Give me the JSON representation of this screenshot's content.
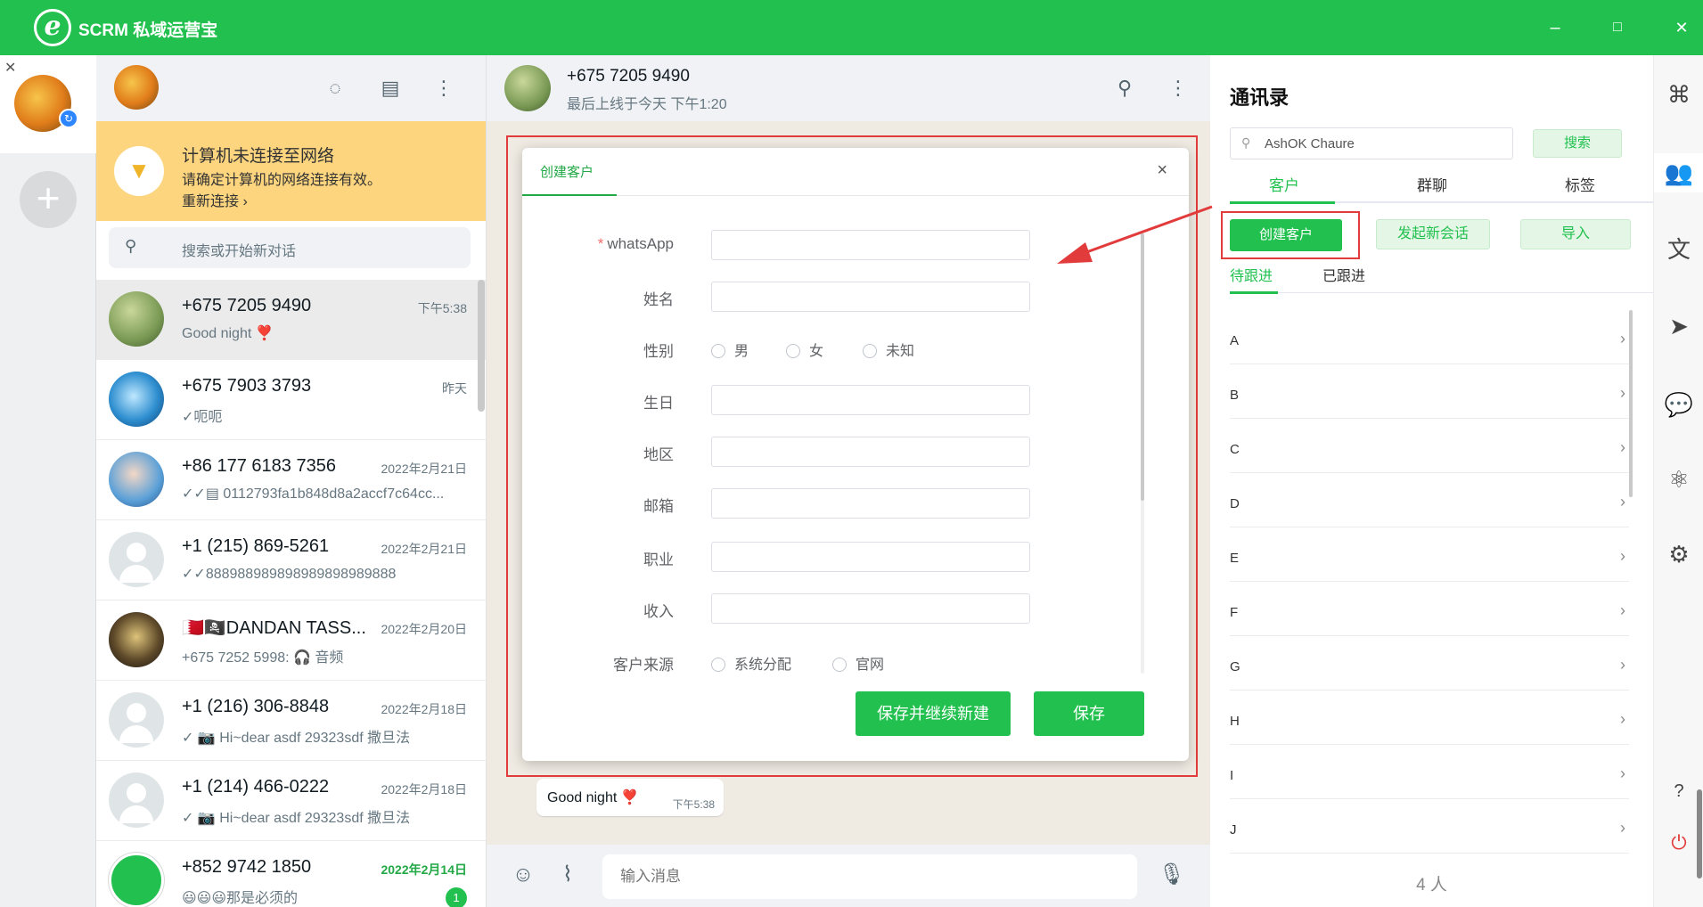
{
  "app": {
    "title": "SCRM 私域运营宝",
    "logo_glyph": "e"
  },
  "window_controls": {
    "minimize": "–",
    "maximize": "□",
    "close": "✕"
  },
  "account": {
    "close": "✕",
    "badge": "↻",
    "add": "+"
  },
  "chatlist": {
    "banner": {
      "title": "计算机未连接至网络",
      "message": "请确定计算机的网络连接有效。",
      "action": "重新连接 ›"
    },
    "search_placeholder": "搜索或开始新对话",
    "chats": [
      {
        "name": "+675 7205 9490",
        "time": "下午5:38",
        "preview": "Good night ❣️"
      },
      {
        "name": "+675 7903 3793",
        "time": "昨天",
        "preview": "✓呃呃"
      },
      {
        "name": "+86 177 6183 7356",
        "time": "2022年2月21日",
        "preview": "✓✓▤ 0112793fa1b848d8a2accf7c64cc..."
      },
      {
        "name": "+1 (215) 869-5261",
        "time": "2022年2月21日",
        "preview": "✓✓888988989898989898989888"
      },
      {
        "name": "🇧🇭🏴‍☠️DANDAN TASS...",
        "time": "2022年2月20日",
        "preview": "+675 7252 5998: 🎧 音频"
      },
      {
        "name": "+1 (216) 306-8848",
        "time": "2022年2月18日",
        "preview": "✓ 📷 Hi~dear asdf 29323sdf 撒旦法"
      },
      {
        "name": "+1 (214) 466-0222",
        "time": "2022年2月18日",
        "preview": "✓ 📷 Hi~dear asdf 29323sdf 撒旦法"
      },
      {
        "name": "+852 9742 1850",
        "time": "2022年2月14日",
        "preview": "😃😃😃那是必须的",
        "unread": "1"
      }
    ]
  },
  "chat": {
    "contact_name": "+675 7205 9490",
    "status": "最后上线于今天 下午1:20",
    "last_message": {
      "text": "Good night ❣️",
      "time": "下午5:38"
    },
    "composer_placeholder": "输入消息"
  },
  "dialog": {
    "tab": "创建客户",
    "close": "×",
    "fields": {
      "whatsapp": {
        "label": "whatsApp",
        "required_mark": "*"
      },
      "name": "姓名",
      "gender": "性别",
      "birthday": "生日",
      "region": "地区",
      "email": "邮箱",
      "occupation": "职业",
      "income": "收入",
      "source": "客户来源"
    },
    "gender_options": [
      "男",
      "女",
      "未知"
    ],
    "source_options": [
      "系统分配",
      "官网"
    ],
    "buttons": {
      "save_and_new": "保存并继续新建",
      "save": "保存"
    }
  },
  "contacts": {
    "title": "通讯录",
    "search_value": "AshOK Chaure",
    "search_button": "搜索",
    "tabs": [
      "客户",
      "群聊",
      "标签"
    ],
    "actions": {
      "create": "创建客户",
      "new_session": "发起新会话",
      "import": "导入"
    },
    "sub_tabs": [
      "待跟进",
      "已跟进"
    ],
    "letters": [
      "A",
      "B",
      "C",
      "D",
      "E",
      "F",
      "G",
      "H",
      "I",
      "J"
    ],
    "count": "4 人"
  },
  "colors": {
    "brand": "#22c14f",
    "annotation": "#e23b3b",
    "banner": "#fdd57e"
  },
  "icons": {
    "rail": [
      "apps-grid-icon",
      "contacts-icon",
      "translate-icon",
      "send-icon",
      "chat-bubble-icon",
      "atom-icon",
      "settings-icon",
      "help-icon",
      "logout-icon"
    ]
  }
}
